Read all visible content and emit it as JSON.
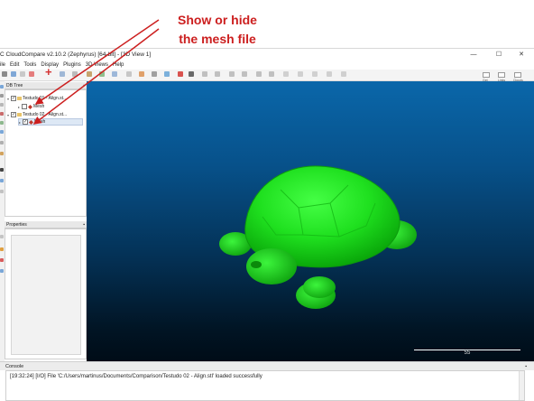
{
  "annotation": {
    "line1": "Show or hide",
    "line2": "the mesh file",
    "color": "#cc1f1f"
  },
  "window": {
    "title": "C CloudCompare v2.10.2 (Zephyrus) [64-bit] - [3D View 1]",
    "minimize": "—",
    "maximize": "☐",
    "close": "✕"
  },
  "menu": [
    "ile",
    "Edit",
    "Tools",
    "Display",
    "Plugins",
    "3D Views",
    "Help"
  ],
  "toolbar_right": [
    {
      "label": "Get",
      "icon": "camera-icon"
    },
    {
      "label": "Links",
      "icon": "links-icon"
    },
    {
      "label": "Clouds",
      "icon": "clouds-icon"
    }
  ],
  "db_tree": {
    "title": "DB Tree",
    "items": [
      {
        "label": "Testudo 01 - Align.st...",
        "checked": "✓"
      },
      {
        "label": "Mesh",
        "checked": ""
      },
      {
        "label": "Testudo 02 - Align.st...",
        "checked": "✓"
      },
      {
        "label": "Mesh",
        "checked": "✓"
      }
    ]
  },
  "properties": {
    "title": "Properties"
  },
  "view": {
    "scale_label": "55",
    "bg_top": "#0a67aa",
    "bg_bottom": "#000c17",
    "mesh_color": "#22dd22"
  },
  "console": {
    "title": "Console",
    "message": "[19:32:24] [I/O] File 'C:/Users/martinus/Documents/Comparison/Testudo 02 - Align.stl' loaded successfully"
  }
}
